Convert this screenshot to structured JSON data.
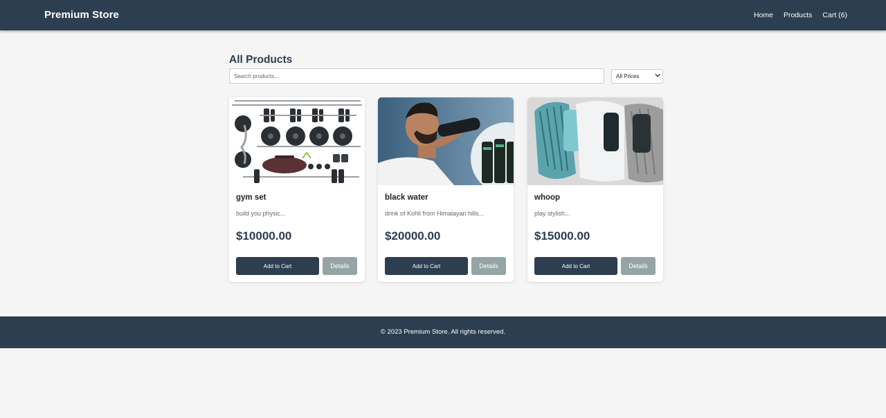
{
  "header": {
    "brand": "Premium Store",
    "nav": [
      "Home",
      "Products",
      "Cart (6)"
    ]
  },
  "main": {
    "title": "All Products",
    "search_placeholder": "Search products...",
    "price_filter": "All Prices"
  },
  "products": [
    {
      "name": "gym set",
      "description": "build you physic...",
      "price": "$10000.00",
      "add_label": "Add to Cart",
      "details_label": "Details",
      "image": "gym-equipment-image"
    },
    {
      "name": "black water",
      "description": "drink of Kohli from Himalayan hills...",
      "price": "$20000.00",
      "add_label": "Add to Cart",
      "details_label": "Details",
      "image": "athlete-drinking-image"
    },
    {
      "name": "whoop",
      "description": "play stylish...",
      "price": "$15000.00",
      "add_label": "Add to Cart",
      "details_label": "Details",
      "image": "fitness-band-image"
    }
  ],
  "footer": {
    "text": "© 2023 Premium Store. All rights reserved."
  },
  "colors": {
    "primary": "#2c3e50",
    "secondary": "#95a5a6",
    "background": "#f5f5f5"
  }
}
